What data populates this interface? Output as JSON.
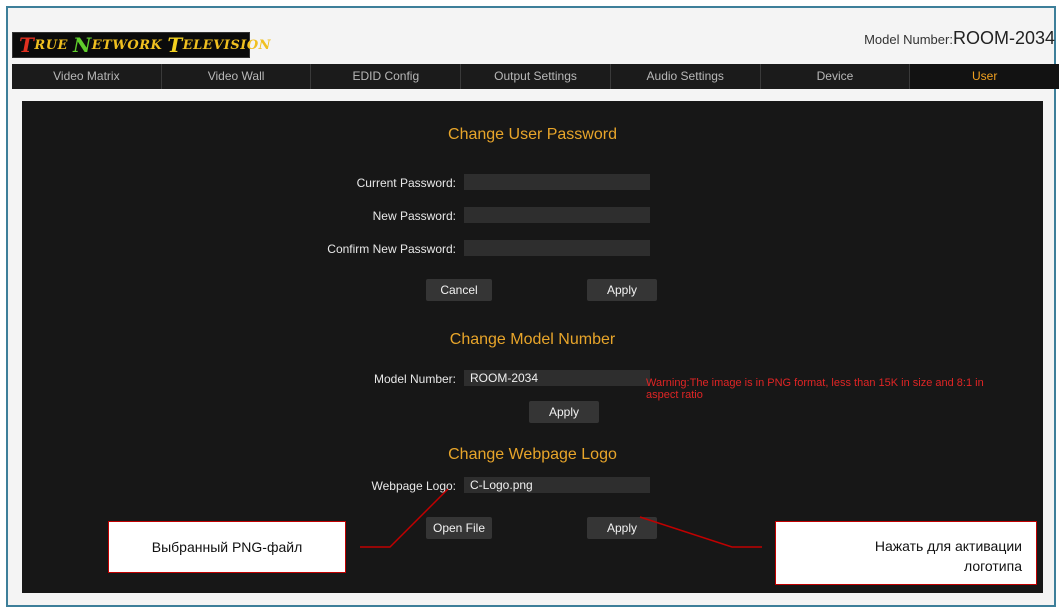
{
  "header": {
    "model_label": "Model Number:",
    "model_value": "ROOM-2034"
  },
  "logo": {
    "w1_cap": "T",
    "w1_rest": "RUE",
    "w2_cap": "N",
    "w2_rest": "ETWORK",
    "w3_cap": "T",
    "w3_rest": "ELEVISION"
  },
  "nav": {
    "items": [
      "Video Matrix",
      "Video Wall",
      "EDID Config",
      "Output Settings",
      "Audio Settings",
      "Device",
      "User"
    ],
    "active": "User"
  },
  "password": {
    "title": "Change User Password",
    "current_label": "Current Password:",
    "new_label": "New Password:",
    "confirm_label": "Confirm New Password:",
    "current_value": "",
    "new_value": "",
    "confirm_value": "",
    "cancel_label": "Cancel",
    "apply_label": "Apply"
  },
  "model": {
    "title": "Change Model Number",
    "label": "Model Number:",
    "value": "ROOM-2034",
    "apply_label": "Apply"
  },
  "logo_section": {
    "title": "Change Webpage Logo",
    "label": "Webpage Logo:",
    "value": "C-Logo.png",
    "warning": "Warning:The image is in PNG format, less than 15K in size and 8:1 in aspect ratio",
    "open_label": "Open File",
    "apply_label": "Apply"
  },
  "callouts": {
    "left": "Выбранный PNG-файл",
    "right_line1": "Нажать для активации",
    "right_line2": "логотипа"
  },
  "colors": {
    "accent": "#e8a52a",
    "warning": "#e02525",
    "callout_border": "#c00000",
    "frame": "#3d7f9a"
  }
}
